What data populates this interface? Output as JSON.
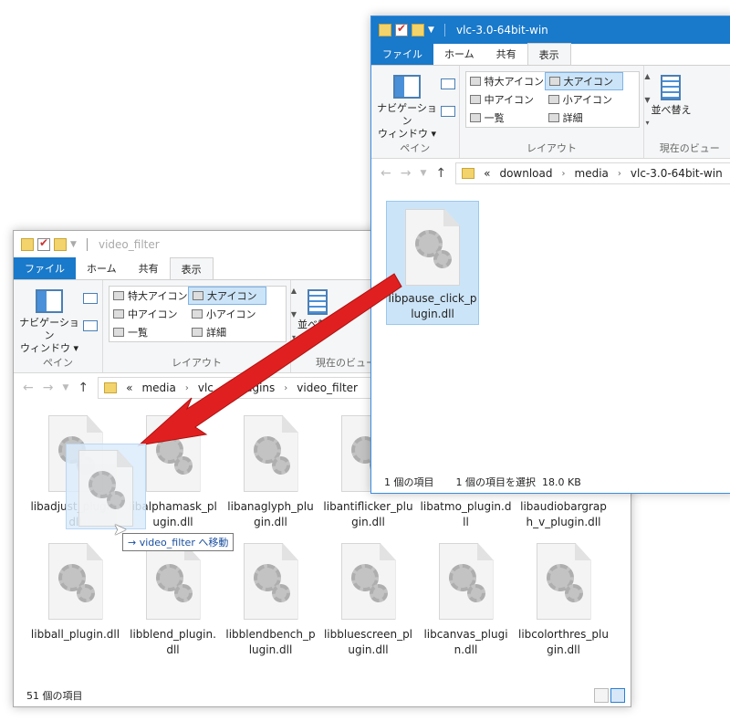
{
  "ribbon": {
    "tabs": [
      "ファイル",
      "ホーム",
      "共有",
      "表示"
    ],
    "nav_pane_label_1": "ナビゲーション",
    "nav_pane_label_2": "ウィンドウ ▾",
    "group_pane": "ペイン",
    "layout_items": [
      "特大アイコン",
      "大アイコン",
      "中アイコン",
      "小アイコン",
      "一覧",
      "詳細"
    ],
    "group_layout": "レイアウト",
    "sort_label": "並べ替え",
    "group_current_view": "現在のビュー"
  },
  "back_window": {
    "title": "video_filter",
    "breadcrumb": [
      "«",
      "media",
      "vlc",
      "plugins",
      "video_filter"
    ],
    "files": [
      "libadjust_plugin.dll",
      "libalphamask_plugin.dll",
      "libanaglyph_plugin.dll",
      "libantiflicker_plugin.dll",
      "libatmo_plugin.dll",
      "libaudiobargraph_v_plugin.dll",
      "libball_plugin.dll",
      "libblend_plugin.dll",
      "libblendbench_plugin.dll",
      "libbluescreen_plugin.dll",
      "libcanvas_plugin.dll",
      "libcolorthres_plugin.dll"
    ],
    "status_count": "51 個の項目"
  },
  "front_window": {
    "title": "vlc-3.0-64bit-win",
    "breadcrumb": [
      "«",
      "download",
      "media",
      "vlc-3.0-64bit-win"
    ],
    "file": "libpause_click_plugin.dll",
    "status_count": "1 個の項目",
    "status_selected": "1 個の項目を選択",
    "status_size": "18.0 KB"
  },
  "drag": {
    "tooltip": "→ video_filter へ移動"
  },
  "colors": {
    "accent_blue": "#1979ca",
    "selection": "#cce4f7",
    "arrow_red": "#e02020"
  }
}
